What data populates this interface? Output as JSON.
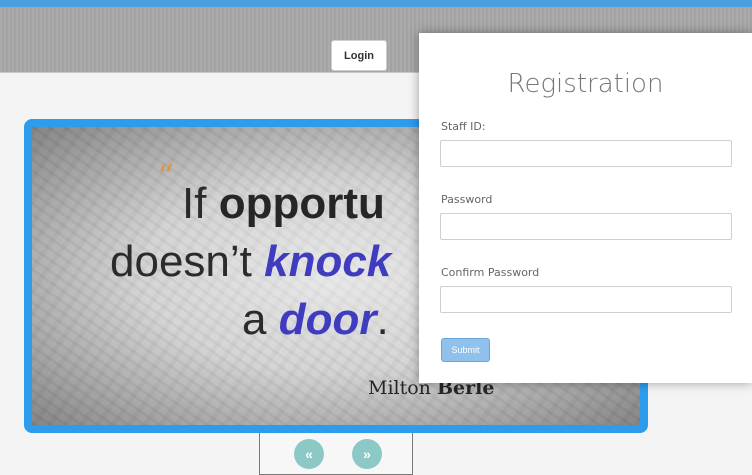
{
  "header": {
    "login_label": "Login"
  },
  "slideshow": {
    "quote_mark": "“",
    "line1_prefix": "If ",
    "line1_bold": "opportu",
    "line2_prefix": "doesn’t ",
    "line2_blue": "knock",
    "line3_prefix": "a ",
    "line3_blue": "door",
    "line3_suffix": ".",
    "author_first": "Milton ",
    "author_last": "Berle",
    "prev_icon": "«",
    "next_icon": "»"
  },
  "registration": {
    "title": "Registration",
    "staff_id_label": "Staff ID:",
    "staff_id_value": "",
    "password_label": "Password",
    "password_value": "",
    "confirm_label": "Confirm Password",
    "confirm_value": "",
    "submit_label": "Submit"
  },
  "colors": {
    "accent": "#4a9fe0",
    "slideshow_border": "#2e9cec",
    "quote_blue": "#3f3cc0",
    "nav_buttons": "#8cc9c6",
    "submit": "#8fc1ec"
  }
}
